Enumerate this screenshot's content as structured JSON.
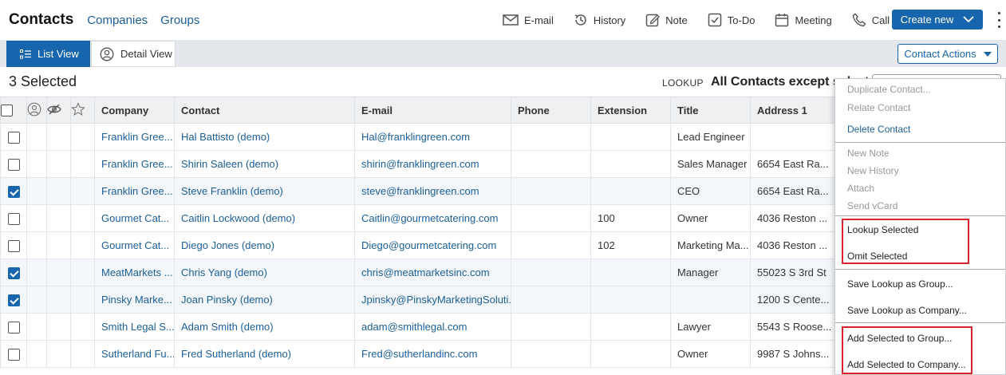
{
  "nav": {
    "title": "Contacts",
    "links": [
      "Companies",
      "Groups"
    ],
    "actions": [
      "E-mail",
      "History",
      "Note",
      "To-Do",
      "Meeting",
      "Call"
    ],
    "create_label": "Create new"
  },
  "views": {
    "list": "List View",
    "detail": "Detail View",
    "contact_actions": "Contact Actions"
  },
  "selection": {
    "count_label": "3 Selected",
    "lookup_label": "LOOKUP",
    "lookup_value": "All Contacts except selected"
  },
  "table": {
    "headers": [
      "Company",
      "Contact",
      "E-mail",
      "Phone",
      "Extension",
      "Title",
      "Address 1"
    ],
    "rows": [
      {
        "checked": false,
        "company": "Franklin Gree...",
        "contact": "Hal Battisto (demo)",
        "email": "Hal@franklingreen.com",
        "phone": "",
        "ext": "",
        "title": "Lead Engineer",
        "address": ""
      },
      {
        "checked": false,
        "company": "Franklin Gree...",
        "contact": "Shirin Saleen (demo)",
        "email": "shirin@franklingreen.com",
        "phone": "",
        "ext": "",
        "title": "Sales Manager",
        "address": "6654 East Ra..."
      },
      {
        "checked": true,
        "company": "Franklin Gree...",
        "contact": "Steve Franklin (demo)",
        "email": "steve@franklingreen.com",
        "phone": "",
        "ext": "",
        "title": "CEO",
        "address": "6654 East Ra..."
      },
      {
        "checked": false,
        "company": "Gourmet Cat...",
        "contact": "Caitlin Lockwood (demo)",
        "email": "Caitlin@gourmetcatering.com",
        "phone": "",
        "ext": "100",
        "title": "Owner",
        "address": "4036 Reston ..."
      },
      {
        "checked": false,
        "company": "Gourmet Cat...",
        "contact": "Diego Jones (demo)",
        "email": "Diego@gourmetcatering.com",
        "phone": "",
        "ext": "102",
        "title": "Marketing Ma...",
        "address": "4036 Reston ..."
      },
      {
        "checked": true,
        "company": "MeatMarkets ...",
        "contact": "Chris Yang (demo)",
        "email": "chris@meatmarketsinc.com",
        "phone": "",
        "ext": "",
        "title": "Manager",
        "address": "55023 S 3rd St"
      },
      {
        "checked": true,
        "company": "Pinsky Marke...",
        "contact": "Joan Pinsky (demo)",
        "email": "Jpinsky@PinskyMarketingSoluti...",
        "phone": "",
        "ext": "",
        "title": "",
        "address": "1200 S Cente..."
      },
      {
        "checked": false,
        "company": "Smith Legal S...",
        "contact": "Adam Smith (demo)",
        "email": "adam@smithlegal.com",
        "phone": "",
        "ext": "",
        "title": "Lawyer",
        "address": "5543 S Roose..."
      },
      {
        "checked": false,
        "company": "Sutherland Fu...",
        "contact": "Fred Sutherland (demo)",
        "email": "Fred@sutherlandinc.com",
        "phone": "",
        "ext": "",
        "title": "Owner",
        "address": "9987 S Johns..."
      }
    ]
  },
  "menu": {
    "items": [
      {
        "label": "Duplicate Contact...",
        "state": "disabled"
      },
      {
        "label": "Relate Contact",
        "state": "disabled"
      },
      {
        "label": "Delete Contact",
        "state": "active"
      },
      {
        "label": "New Note",
        "state": "disabled"
      },
      {
        "label": "New History",
        "state": "disabled"
      },
      {
        "label": "Attach",
        "state": "disabled"
      },
      {
        "label": "Send vCard",
        "state": "disabled"
      },
      {
        "label": "Lookup Selected",
        "state": "normal"
      },
      {
        "label": "Omit Selected",
        "state": "normal"
      },
      {
        "label": "Save Lookup as Group...",
        "state": "normal"
      },
      {
        "label": "Save Lookup as Company...",
        "state": "normal"
      },
      {
        "label": "Add Selected to Group...",
        "state": "normal"
      },
      {
        "label": "Add Selected to Company...",
        "state": "normal"
      }
    ]
  },
  "colors": {
    "accent": "#1765ad",
    "link": "#1b5e9a",
    "highlight": "#d9232e"
  }
}
